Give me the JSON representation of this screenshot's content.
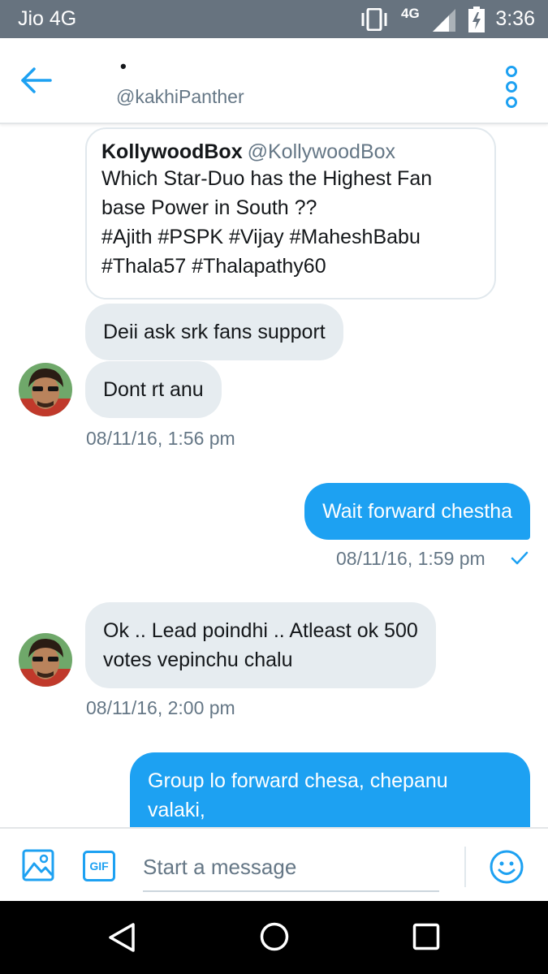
{
  "status_bar": {
    "carrier": "Jio 4G",
    "network": "4G",
    "time": "3:36",
    "icons": [
      "vibrate-icon",
      "signal-icon",
      "battery-charging-icon"
    ]
  },
  "header": {
    "name": "•",
    "handle": "@kakhiPanther",
    "back_icon": "arrow-left-icon",
    "more_icon": "vertical-dots-icon"
  },
  "quoted_tweet": {
    "name": "KollywoodBox",
    "handle": "@KollywoodBox",
    "lines": [
      "Which Star-Duo has the Highest Fan",
      "base Power in South ??",
      "#Ajith #PSPK #Vijay #MaheshBabu",
      "#Thala57 #Thalapathy60"
    ]
  },
  "messages": [
    {
      "direction": "in",
      "lines": [
        "Deii ask srk fans support"
      ]
    },
    {
      "direction": "in",
      "lines": [
        "Dont rt anu"
      ],
      "timestamp": "08/11/16, 1:56 pm"
    },
    {
      "direction": "out",
      "lines": [
        "Wait forward chestha"
      ],
      "timestamp": "08/11/16, 1:59 pm"
    },
    {
      "direction": "in",
      "lines": [
        "Ok .. Lead poindhi .. Atleast ok 500",
        "votes vepinchu chalu"
      ],
      "timestamp": "08/11/16, 2:00 pm"
    },
    {
      "direction": "out",
      "lines": [
        "Group lo forward chesa, chepanu",
        "valaki,"
      ]
    }
  ],
  "composer": {
    "placeholder": "Start a message",
    "image_icon": "image-icon",
    "gif_label": "GIF",
    "emoji_icon": "smiley-icon"
  },
  "nav_bar": {
    "icons": [
      "nav-back-icon",
      "nav-home-icon",
      "nav-recents-icon"
    ]
  },
  "colors": {
    "status_bar": "#67737f",
    "accent": "#1da1f2",
    "incoming_bubble": "#e6ecf0",
    "secondary_text": "#657786"
  }
}
